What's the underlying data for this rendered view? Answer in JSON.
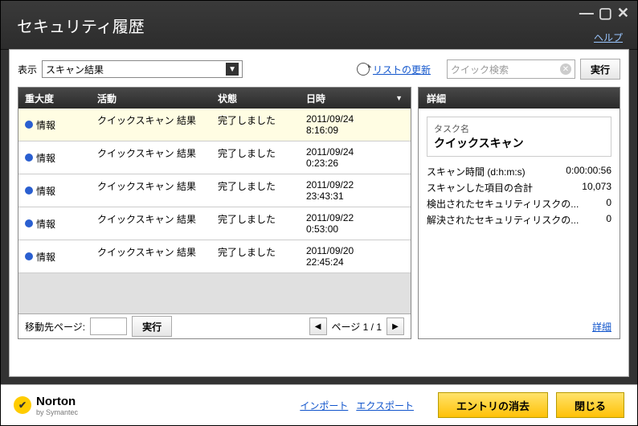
{
  "window": {
    "title": "セキュリティ履歴",
    "help": "ヘルプ"
  },
  "filter": {
    "label": "表示",
    "value": "スキャン結果",
    "refresh": "リストの更新"
  },
  "search": {
    "placeholder": "クイック検索",
    "go": "実行"
  },
  "columns": {
    "severity": "重大度",
    "activity": "活動",
    "status": "状態",
    "datetime": "日時"
  },
  "rows": [
    {
      "sev": "情報",
      "act": "クイックスキャン 結果",
      "stat": "完了しました",
      "dt": "2011/09/24 8:16:09"
    },
    {
      "sev": "情報",
      "act": "クイックスキャン 結果",
      "stat": "完了しました",
      "dt": "2011/09/24 0:23:26"
    },
    {
      "sev": "情報",
      "act": "クイックスキャン 結果",
      "stat": "完了しました",
      "dt": "2011/09/22 23:43:31"
    },
    {
      "sev": "情報",
      "act": "クイックスキャン 結果",
      "stat": "完了しました",
      "dt": "2011/09/22 0:53:00"
    },
    {
      "sev": "情報",
      "act": "クイックスキャン 結果",
      "stat": "完了しました",
      "dt": "2011/09/20 22:45:24"
    }
  ],
  "pager": {
    "label": "移動先ページ:",
    "go": "実行",
    "pages": "ページ 1 / 1"
  },
  "details": {
    "header": "詳細",
    "task_label": "タスク名",
    "task_name": "クイックスキャン",
    "stats": [
      {
        "k": "スキャン時間 (d:h:m:s)",
        "v": "0:00:00:56"
      },
      {
        "k": "スキャンした項目の合計",
        "v": "10,073"
      },
      {
        "k": "検出されたセキュリティリスクの...",
        "v": "0"
      },
      {
        "k": "解決されたセキュリティリスクの...",
        "v": "0"
      }
    ],
    "more": "詳細"
  },
  "footer": {
    "brand": "Norton",
    "sub": "by Symantec",
    "import": "インポート",
    "export": "エクスポート",
    "clear": "エントリの消去",
    "close": "閉じる"
  }
}
